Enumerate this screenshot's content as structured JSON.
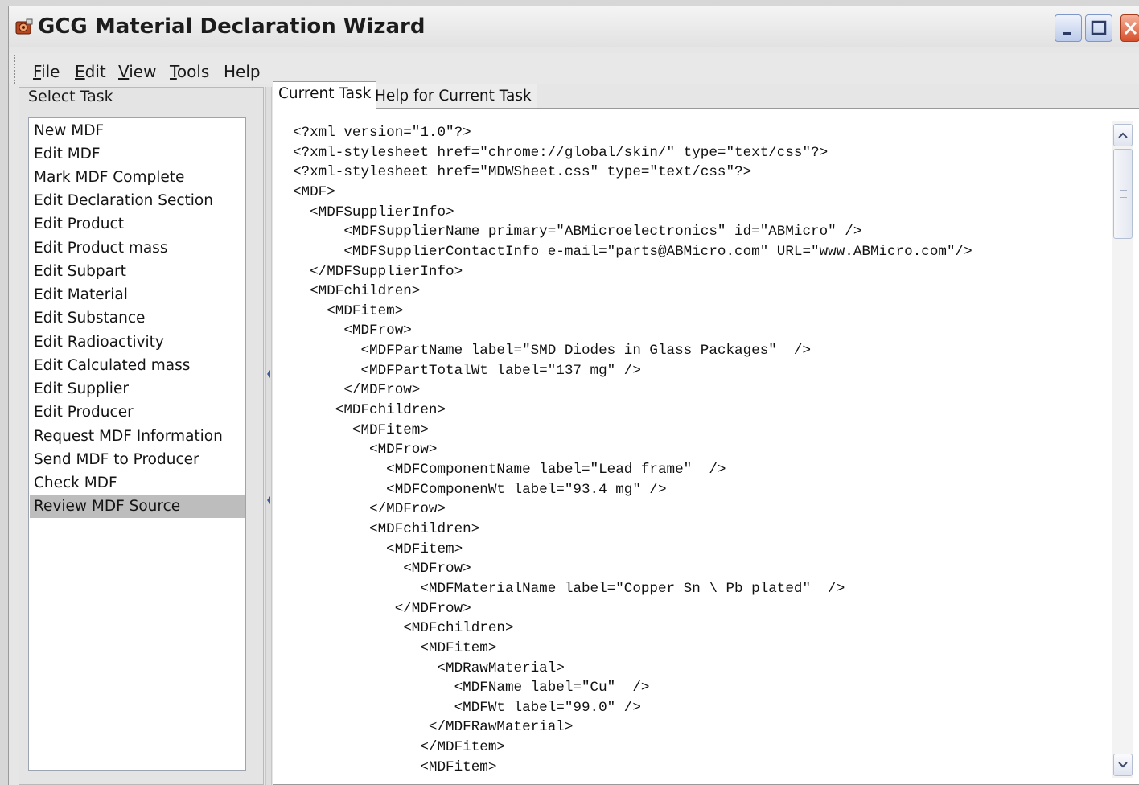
{
  "window": {
    "title": "GCG Material Declaration Wizard",
    "icon": "app-gear-icon"
  },
  "menubar": {
    "items": [
      {
        "mnemonic": "F",
        "rest": "ile"
      },
      {
        "mnemonic": "E",
        "rest": "dit"
      },
      {
        "mnemonic": "V",
        "rest": "iew"
      },
      {
        "mnemonic": "T",
        "rest": "ools"
      },
      {
        "mnemonic": "",
        "rest": "Help"
      }
    ]
  },
  "left_panel": {
    "title": "Select Task",
    "tasks": [
      "New MDF",
      "Edit MDF",
      "Mark MDF Complete",
      "Edit Declaration Section",
      "Edit Product",
      "Edit Product mass",
      "Edit Subpart",
      "Edit Material",
      "Edit Substance",
      "Edit Radioactivity",
      "Edit Calculated mass",
      "Edit Supplier",
      "Edit Producer",
      "Request MDF Information",
      "Send MDF to Producer",
      "Check MDF",
      "Review MDF Source"
    ],
    "selected_task": "Review MDF Source"
  },
  "tabs": {
    "current": "Current Task",
    "help": "Help for Current Task"
  },
  "source": {
    "lines": [
      "<?xml version=\"1.0\"?>",
      "<?xml-stylesheet href=\"chrome://global/skin/\" type=\"text/css\"?>",
      "<?xml-stylesheet href=\"MDWSheet.css\" type=\"text/css\"?>",
      "<MDF>",
      "  <MDFSupplierInfo>",
      "      <MDFSupplierName primary=\"ABMicroelectronics\" id=\"ABMicro\" />",
      "      <MDFSupplierContactInfo e-mail=\"parts@ABMicro.com\" URL=\"www.ABMicro.com\"/>",
      "  </MDFSupplierInfo>",
      "  <MDFchildren>",
      "    <MDFitem>",
      "      <MDFrow>",
      "        <MDFPartName label=\"SMD Diodes in Glass Packages\"  />",
      "        <MDFPartTotalWt label=\"137 mg\" />",
      "      </MDFrow>",
      "     <MDFchildren>",
      "       <MDFitem>",
      "         <MDFrow>",
      "           <MDFComponentName label=\"Lead frame\"  />",
      "           <MDFComponenWt label=\"93.4 mg\" />",
      "         </MDFrow>",
      "         <MDFchildren>",
      "           <MDFitem>",
      "             <MDFrow>",
      "               <MDFMaterialName label=\"Copper Sn \\ Pb plated\"  />",
      "            </MDFrow>",
      "             <MDFchildren>",
      "               <MDFitem>",
      "                 <MDRawMaterial>",
      "                   <MDFName label=\"Cu\"  />",
      "                   <MDFWt label=\"99.0\" />",
      "                </MDFRawMaterial>",
      "               </MDFitem>",
      "               <MDFitem>"
    ]
  },
  "scrollbar": {
    "up_icon": "chevron-up-icon",
    "down_icon": "chevron-down-icon",
    "position": 0.0
  }
}
